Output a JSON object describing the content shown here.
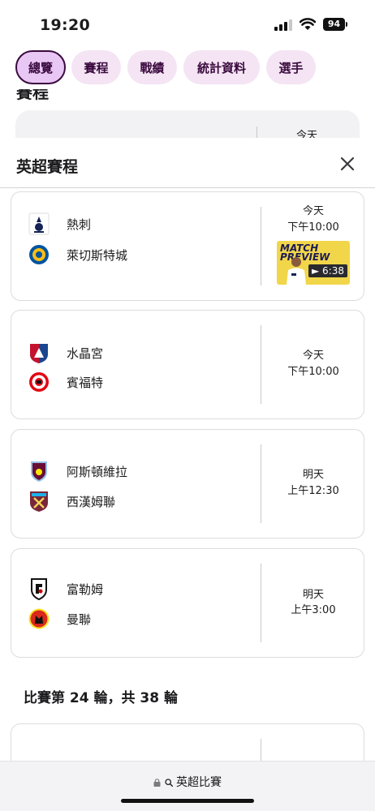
{
  "status_bar": {
    "time": "19:20",
    "battery": "94"
  },
  "tabs": [
    {
      "label": "總覽",
      "active": true
    },
    {
      "label": "賽程",
      "active": false
    },
    {
      "label": "戰績",
      "active": false
    },
    {
      "label": "統計資料",
      "active": false
    },
    {
      "label": "選手",
      "active": false
    }
  ],
  "background": {
    "heading": "賽程",
    "first_card_time": "今天"
  },
  "sheet": {
    "title": "英超賽程",
    "close_icon": "close-icon",
    "matches": [
      {
        "home": "熱刺",
        "away": "萊切斯特城",
        "day": "今天",
        "time": "下午10:00",
        "preview": {
          "title_line1": "MATCH",
          "title_line2": "PREVIEW",
          "duration": "► 6:38"
        }
      },
      {
        "home": "水晶宮",
        "away": "賓福特",
        "day": "今天",
        "time": "下午10:00"
      },
      {
        "home": "阿斯頓維拉",
        "away": "西漢姆聯",
        "day": "明天",
        "time": "上午12:30"
      },
      {
        "home": "富勒姆",
        "away": "曼聯",
        "day": "明天",
        "time": "上午3:00"
      }
    ],
    "round_heading": "比賽第 24 輪，共 38 輪"
  },
  "browser": {
    "url": "英超比賽"
  },
  "colors": {
    "tab_bg": "#f4e4f4",
    "tab_active_bg": "#e9c7f5",
    "tab_text": "#3a0a3e"
  }
}
